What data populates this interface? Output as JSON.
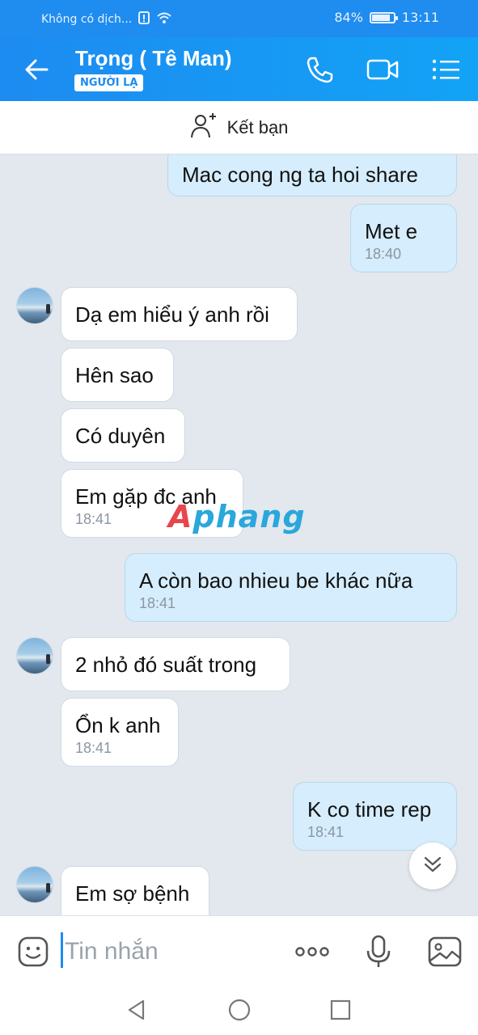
{
  "status_bar": {
    "carrier": "Không có dịch...",
    "battery_percent": "84%",
    "battery_level": 0.84,
    "time": "13:11"
  },
  "header": {
    "contact_name": "Trọng ( Tê Man)",
    "badge": "NGƯỜI LẠ",
    "icons": [
      "back-arrow-icon",
      "phone-icon",
      "video-call-icon",
      "menu-list-icon"
    ]
  },
  "add_friend": {
    "label": "Kết bạn",
    "icon": "add-person-icon"
  },
  "messages": [
    {
      "from": "me",
      "text": "Mac cong ng ta hoi share",
      "time": ""
    },
    {
      "from": "me",
      "text": "Met e",
      "time": "18:40"
    },
    {
      "from": "them",
      "text": "Dạ em hiểu ý anh rồi",
      "time": ""
    },
    {
      "from": "them",
      "text": "Hên sao",
      "time": ""
    },
    {
      "from": "them",
      "text": "Có duyên",
      "time": ""
    },
    {
      "from": "them",
      "text": "Em gặp đc anh",
      "time": "18:41"
    },
    {
      "from": "me",
      "text": "A còn bao nhieu be khác nữa",
      "time": "18:41"
    },
    {
      "from": "them",
      "text": "2 nhỏ đó suất trong",
      "time": ""
    },
    {
      "from": "them",
      "text": "Ổn k anh",
      "time": "18:41"
    },
    {
      "from": "me",
      "text": "K co time rep",
      "time": "18:41"
    },
    {
      "from": "them",
      "text": "Em sợ bệnh",
      "time": ""
    }
  ],
  "watermark": {
    "part1": "A",
    "part2": "phang"
  },
  "composer": {
    "placeholder": "Tin nhắn",
    "icons": [
      "sticker-icon",
      "more-icon",
      "microphone-icon",
      "image-icon"
    ]
  },
  "colors": {
    "accent": "#1d8bf1",
    "my_bubble": "#d5edfc",
    "their_bubble": "#ffffff",
    "background": "#e3e8ee"
  }
}
